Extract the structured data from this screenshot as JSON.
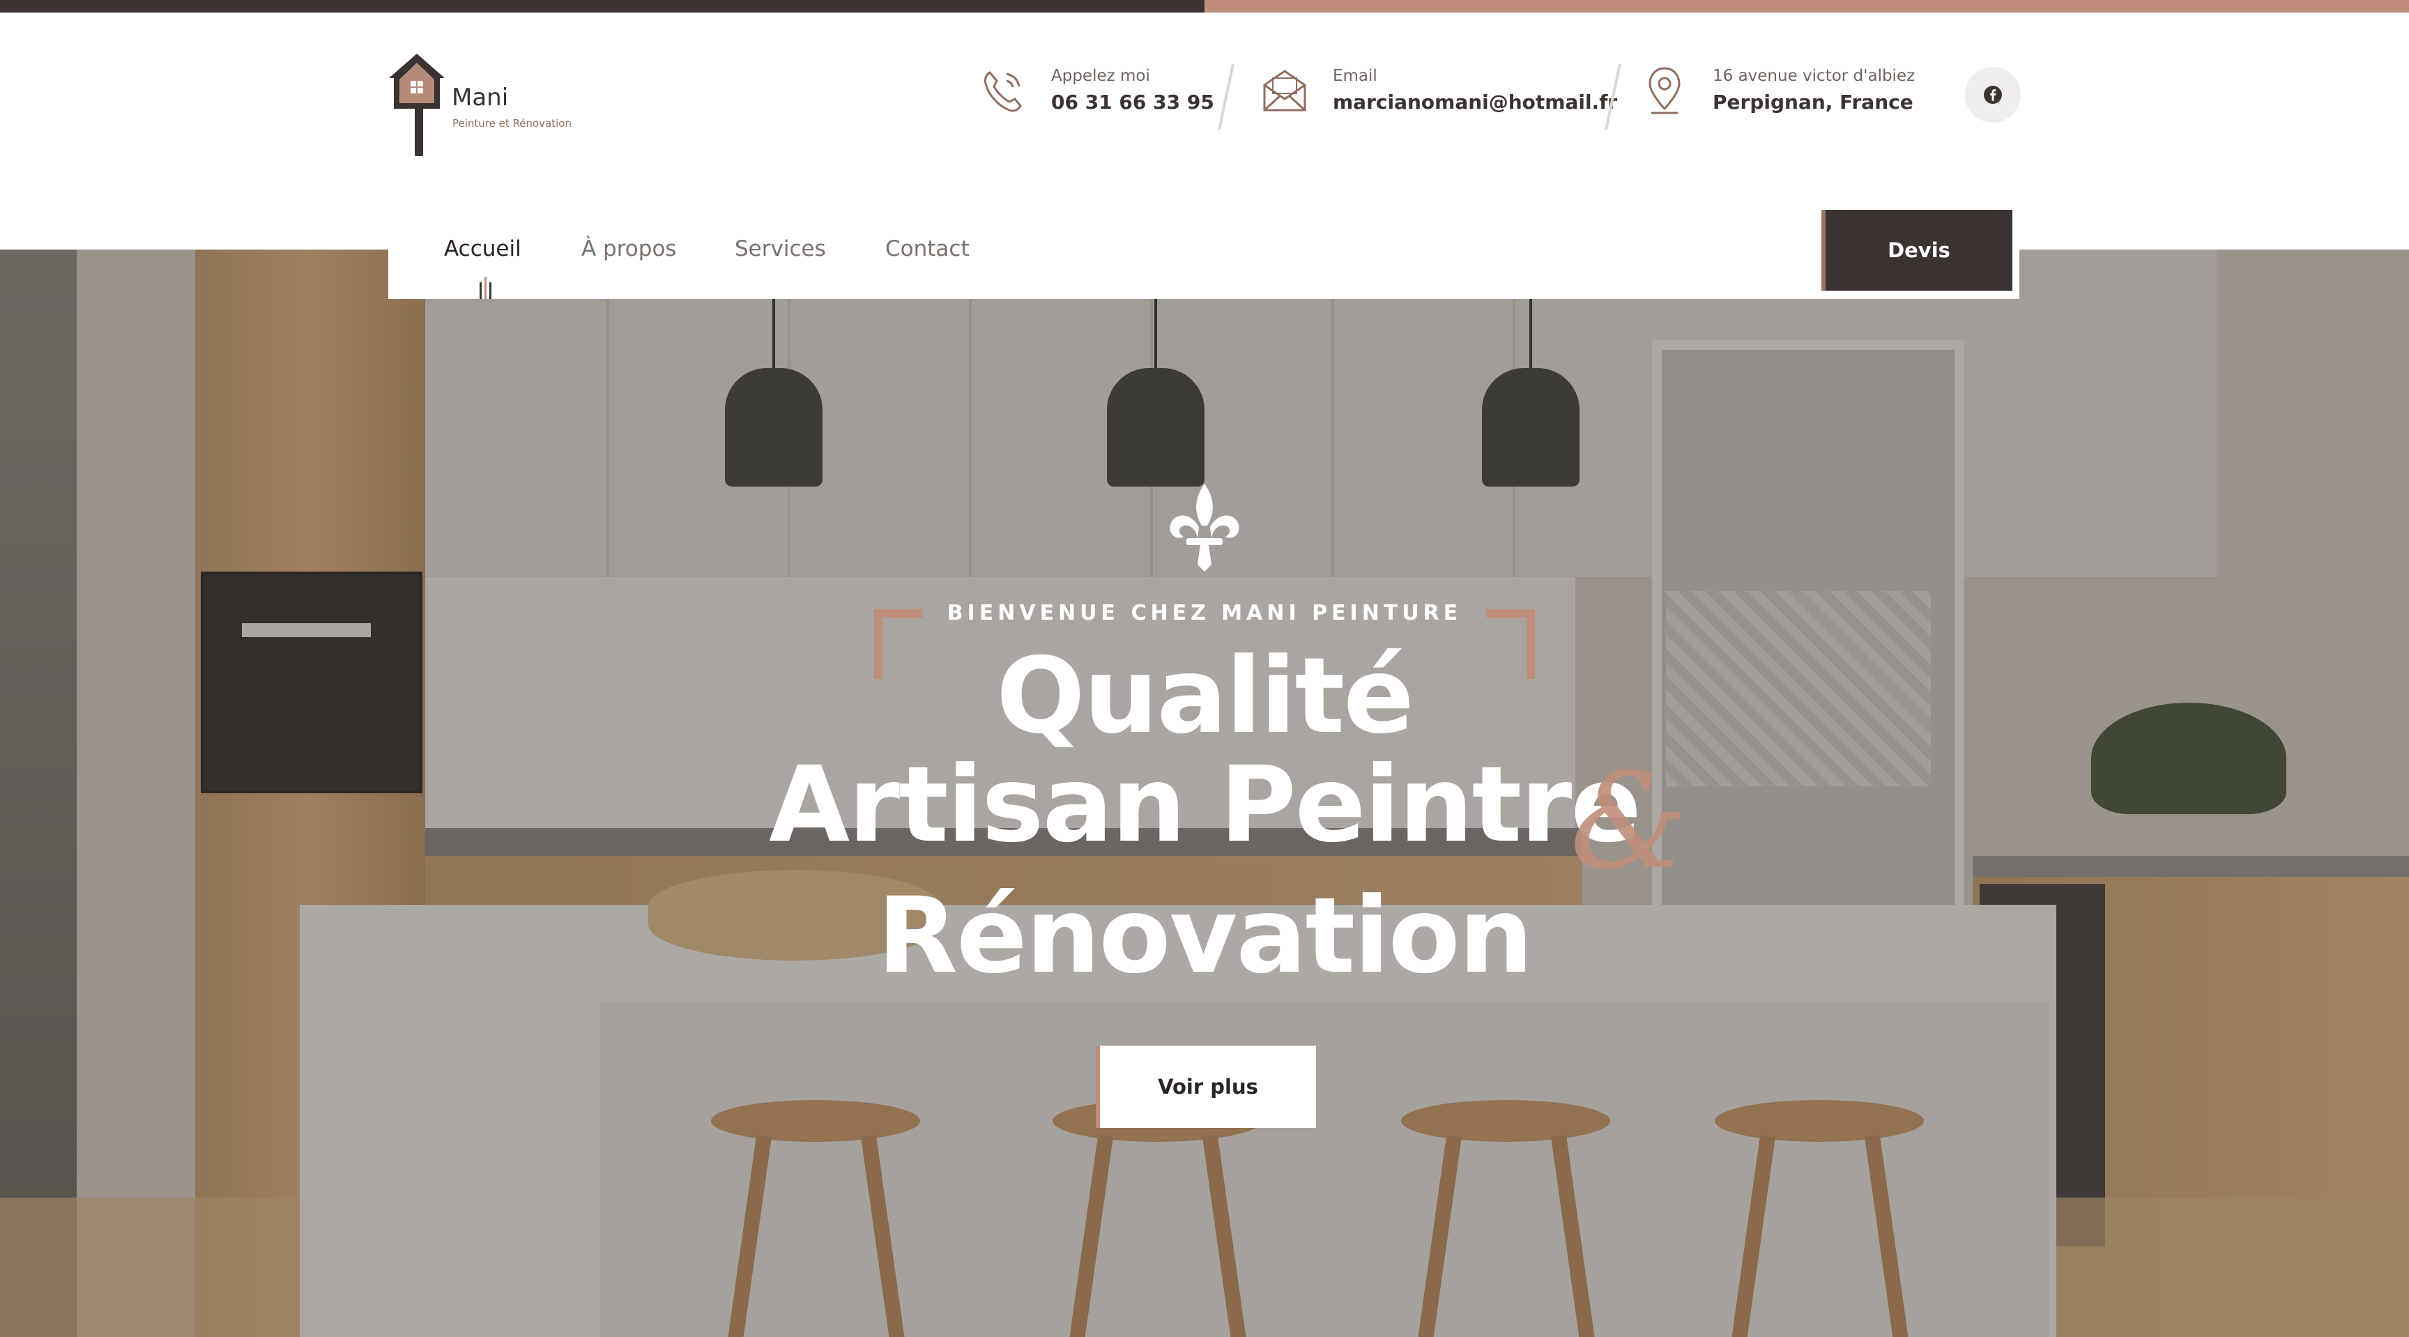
{
  "logo": {
    "name": "Mani",
    "tagline": "Peinture et Rénovation"
  },
  "contacts": [
    {
      "label": "Appelez moi",
      "value": "06 31 66 33 95",
      "icon": "phone-icon"
    },
    {
      "label": "Email",
      "value": "marcianomani@hotmail.fr",
      "icon": "envelope-icon"
    },
    {
      "label": "16 avenue victor d'albiez",
      "value": "Perpignan, France",
      "icon": "location-pin-icon"
    }
  ],
  "social": {
    "icon": "facebook-icon",
    "glyph": "f"
  },
  "nav": {
    "items": [
      {
        "label": "Accueil",
        "active": true
      },
      {
        "label": "À propos",
        "active": false
      },
      {
        "label": "Services",
        "active": false
      },
      {
        "label": "Contact",
        "active": false
      }
    ],
    "cta_label": "Devis"
  },
  "hero": {
    "kicker": "BIENVENUE CHEZ MANI PEINTURE",
    "title_line1": "Qualité",
    "title_line2": "Artisan Peintre",
    "title_line3": "Rénovation",
    "ampersand": "&",
    "button_label": "Voir plus"
  },
  "colors": {
    "dark": "#3a3331",
    "accent": "#c08e7b",
    "white": "#ffffff"
  }
}
